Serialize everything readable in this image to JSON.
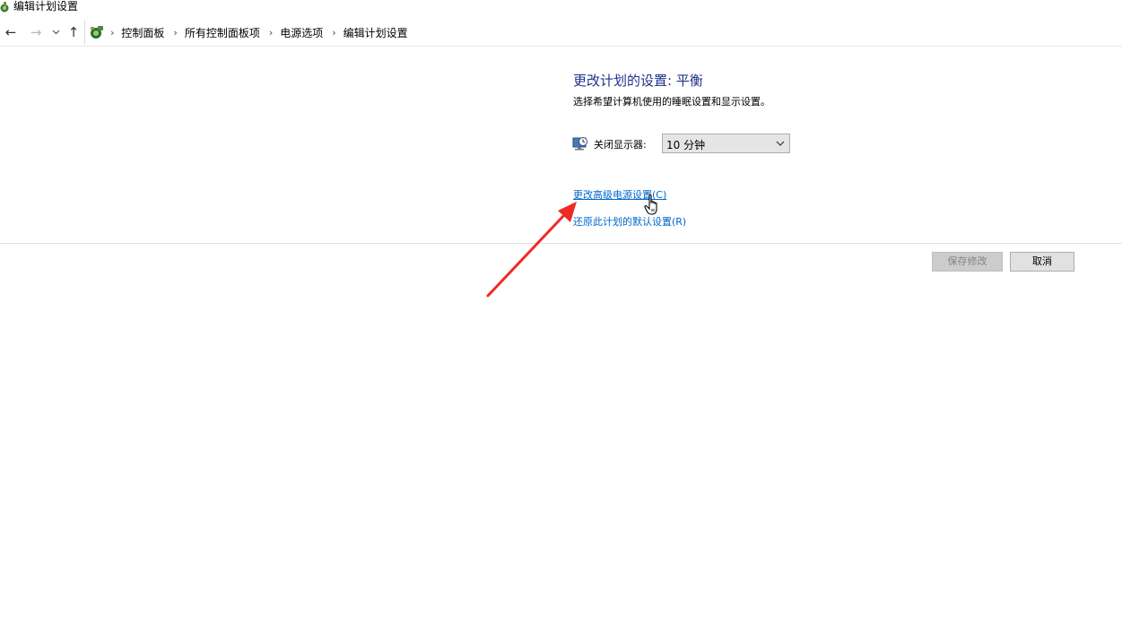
{
  "window": {
    "title": "编辑计划设置",
    "icon": "power-options-icon"
  },
  "navigation": {
    "back_icon": "←",
    "forward_icon": "→",
    "recent_icon": "⌄",
    "up_icon": "↑",
    "address_icon": "control-panel-icon",
    "breadcrumb_separator": "›",
    "breadcrumbs": [
      "控制面板",
      "所有控制面板项",
      "电源选项",
      "编辑计划设置"
    ]
  },
  "main": {
    "heading": "更改计划的设置: 平衡",
    "subheading": "选择希望计算机使用的睡眠设置和显示设置。",
    "display_off": {
      "icon": "monitor-clock-icon",
      "label": "关闭显示器:",
      "selected_value": "10 分钟"
    },
    "links": {
      "advanced": "更改高级电源设置(C)",
      "restore": "还原此计划的默认设置(R)"
    }
  },
  "footer": {
    "save_label": "保存修改",
    "cancel_label": "取消"
  },
  "colors": {
    "heading": "#1e3287",
    "link": "#0066cc",
    "annotation_arrow": "#ee2a24"
  }
}
